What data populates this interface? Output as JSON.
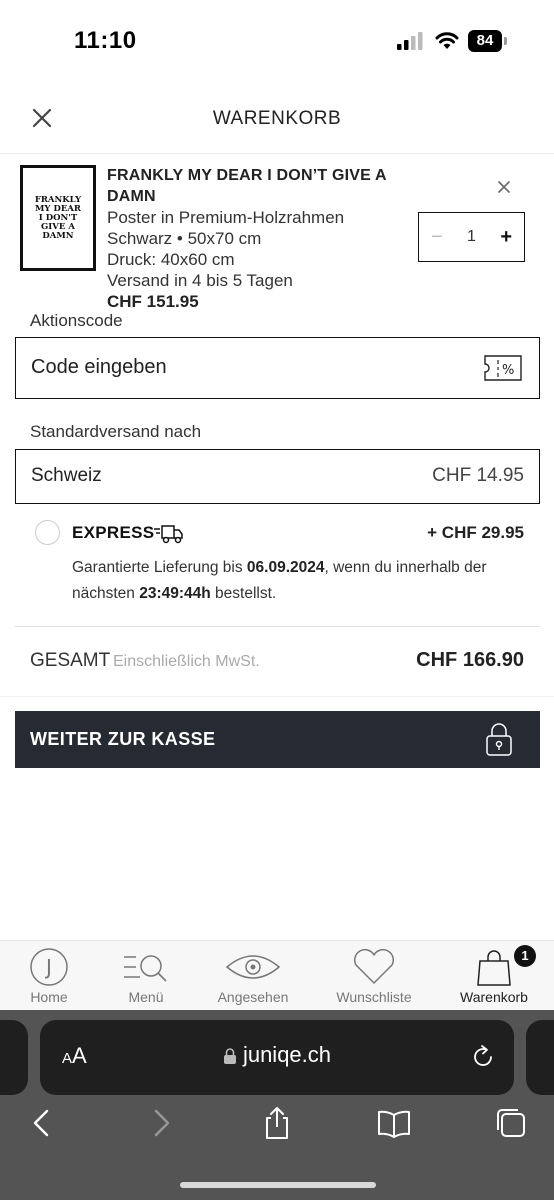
{
  "status_bar": {
    "time": "11:10",
    "battery": "84"
  },
  "header": {
    "title": "WARENKORB"
  },
  "item": {
    "thumbnail_lines": [
      "FRANKLY",
      "MY DEAR",
      "I DON'T",
      "GIVE A",
      "DAMN"
    ],
    "name": "FRANKLY MY DEAR I DON’T GIVE A DAMN",
    "product": "Poster in Premium-Holzrahmen",
    "variant": "Schwarz • 50x70 cm",
    "print": "Druck: 40x60 cm",
    "shipping_time": "Versand in 4 bis 5 Tagen",
    "price": "CHF 151.95",
    "quantity": "1",
    "qty_minus": "−",
    "qty_plus": "+"
  },
  "promo": {
    "label": "Aktionscode",
    "placeholder": "Code eingeben",
    "icon_text": "%"
  },
  "shipping": {
    "label": "Standardversand nach",
    "country": "Schweiz",
    "price": "CHF 14.95"
  },
  "express": {
    "label": "EXPRESS",
    "price": "+ CHF 29.95",
    "text_1": "Garantierte Lieferung bis ",
    "date": "06.09.2024",
    "text_2": ", wenn du innerhalb der nächsten ",
    "countdown": "23:49:44h",
    "text_3": " bestellst."
  },
  "total": {
    "label": "GESAMT",
    "note": "Einschließlich MwSt.",
    "value": "CHF 166.90"
  },
  "checkout": {
    "label": "WEITER ZUR KASSE"
  },
  "nav": {
    "home": "Home",
    "menu": "Menü",
    "viewed": "Angesehen",
    "wishlist": "Wunschliste",
    "cart": "Warenkorb",
    "cart_badge": "1",
    "home_letter": "J"
  },
  "safari": {
    "aa_small": "A",
    "aa_large": "A",
    "url": "juniqe.ch"
  },
  "colors": {
    "checkout_bg": "#262a33",
    "safari_bg": "#545454",
    "url_bar_bg": "#1f1f1f"
  }
}
